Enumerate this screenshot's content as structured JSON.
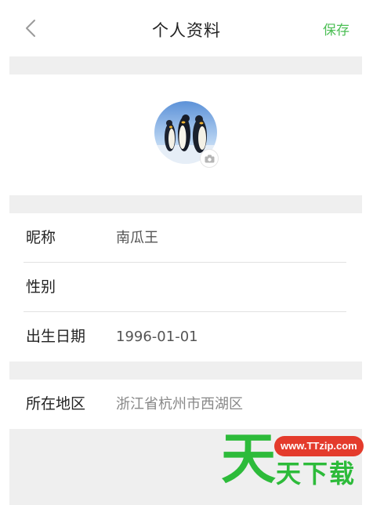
{
  "header": {
    "title": "个人资料",
    "save_label": "保存",
    "accent_color": "#4cbf55"
  },
  "avatar": {
    "image": "penguins-photo",
    "badge_icon": "camera-icon"
  },
  "profile": {
    "nickname_label": "昵称",
    "nickname_value": "南瓜王",
    "gender_label": "性别",
    "gender_value": "",
    "birthday_label": "出生日期",
    "birthday_value": "1996-01-01",
    "region_label": "所在地区",
    "region_value": "浙江省杭州市西湖区"
  },
  "watermark": {
    "url": "www.TTzip.com",
    "big_char": "天",
    "text": "天下载"
  }
}
